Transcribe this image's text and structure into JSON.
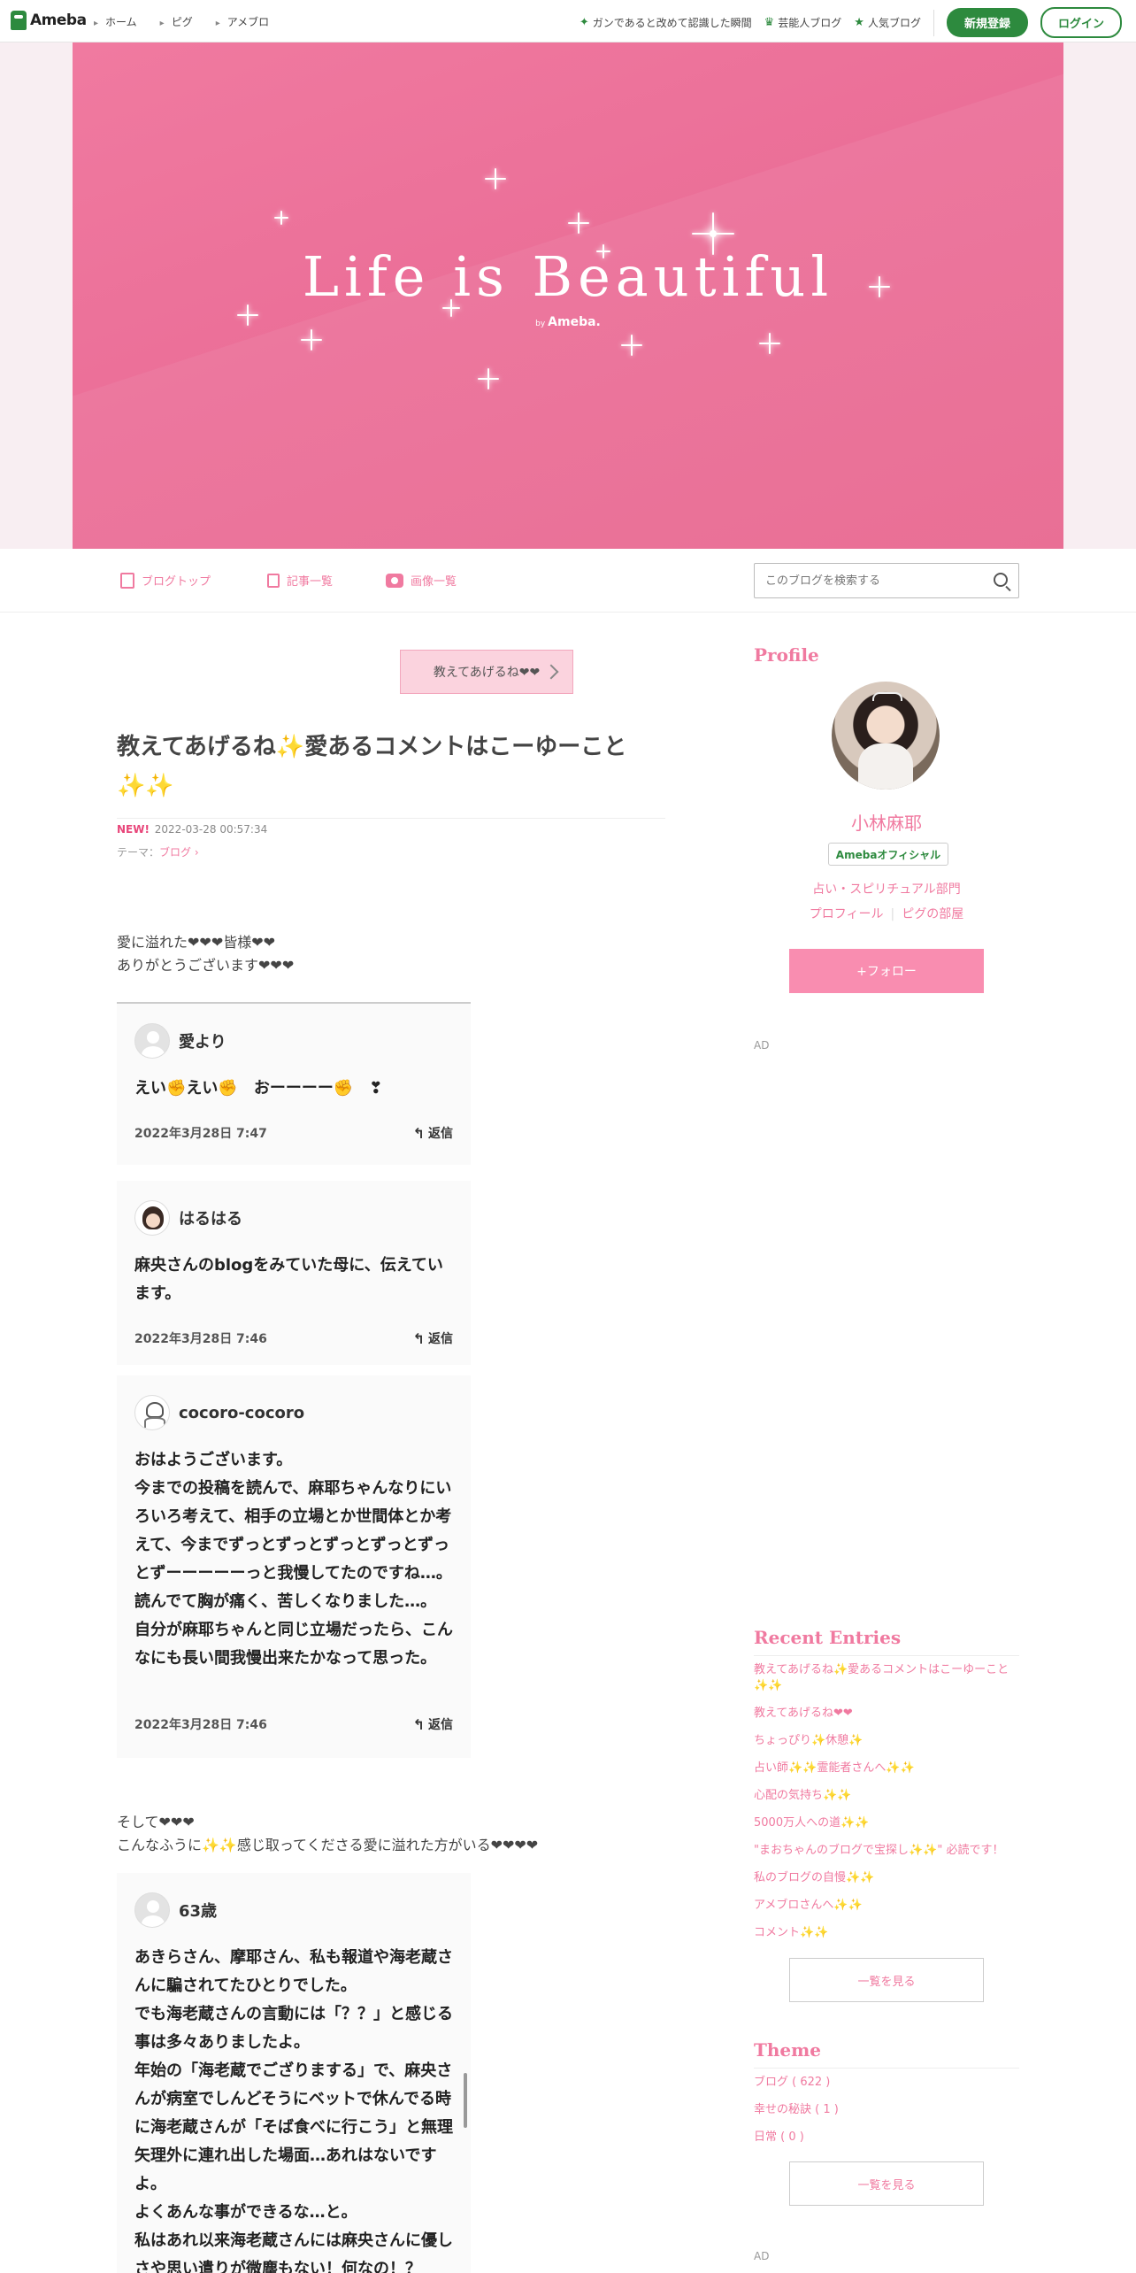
{
  "topbar": {
    "logo_text": "Ameba",
    "nav": [
      "ホーム",
      "ピグ",
      "アメブロ"
    ],
    "right_links": [
      {
        "icon": "sparkle-icon",
        "label": "ガンであると改めて認識した瞬間"
      },
      {
        "icon": "crown-icon",
        "label": "芸能人ブログ"
      },
      {
        "icon": "star-icon",
        "label": "人気ブログ"
      }
    ],
    "signup": "新規登録",
    "login": "ログイン"
  },
  "hero": {
    "title": "Life is Beautiful",
    "by_prefix": "by",
    "by_brand": "Ameba."
  },
  "blognav": {
    "items": [
      "ブログトップ",
      "記事一覧",
      "画像一覧"
    ],
    "search_placeholder": "このブログを検索する"
  },
  "entry": {
    "tag_button": "教えてあげるね❤❤",
    "title": "教えてあげるね✨愛あるコメントはこーゆーこと✨✨",
    "new_label": "NEW!",
    "date": "2022-03-28 00:57:34",
    "theme_label": "テーマ：",
    "theme_value": "ブログ",
    "intro_line1": "愛に溢れた❤❤❤皆様❤❤",
    "intro_line2": "ありがとうございます❤❤❤",
    "mid_line1": "そして❤❤❤",
    "mid_line2": "こんなふうに✨✨感じ取ってくださる愛に溢れた方がいる❤❤❤❤",
    "reply_label": "返信",
    "comments": [
      {
        "name": "愛より",
        "text": "えい✊えい✊　おーーーー✊　❣",
        "date": "2022年3月28日 7:47"
      },
      {
        "name": "はるはる",
        "text": "麻央さんのblogをみていた母に、伝えています。",
        "date": "2022年3月28日 7:46"
      },
      {
        "name": "cocoro-cocoro",
        "text": "おはようございます。\n今までの投稿を読んで、麻耶ちゃんなりにいろいろ考えて、相手の立場とか世間体とか考えて、今までずっとずっとずっとずっとずっとずーーーーーっと我慢してたのですね…。\n読んでて胸が痛く、苦しくなりました…。\n自分が麻耶ちゃんと同じ立場だったら、こんなにも長い間我慢出来たかなって思った。",
        "date": "2022年3月28日 7:46"
      },
      {
        "name": "63歳",
        "text": "あきらさん、摩耶さん、私も報道や海老蔵さんに騙されてたひとりでした。\nでも海老蔵さんの言動には「？？」と感じる事は多々ありましたよ。\n年始の「海老蔵でござりまする」で、麻央さんが病室でしんどそうにベットで休んでる時に海老蔵さんが「そば食べに行こう」と無理矢理外に連れ出した場面…あれはないですよ。\nよくあんな事ができるな…と。\n私はあれ以来海老蔵さんには麻央さんに優しさや思い遣りが微塵もない！何なの！？",
        "date": ""
      }
    ]
  },
  "sidebar": {
    "profile_heading": "Profile",
    "name": "小林麻耶",
    "badge": "Amebaオフィシャル",
    "category": "占い・スピリチュアル部門",
    "link_profile": "プロフィール",
    "link_pig": "ピグの部屋",
    "follow": "+フォロー",
    "ad": "AD",
    "recent_heading": "Recent Entries",
    "recent": [
      "教えてあげるね✨愛あるコメントはこーゆーこと✨✨",
      "教えてあげるね❤❤",
      "ちょっぴり✨休憩✨",
      "占い師✨✨霊能者さんへ✨✨",
      "心配の気持ち✨✨",
      "5000万人への道✨✨",
      "\"まおちゃんのブログで宝探し✨✨\" 必読です！",
      "私のブログの自慢✨✨",
      "アメブロさんへ✨✨",
      "コメント✨✨"
    ],
    "more": "一覧を見る",
    "theme_heading": "Theme",
    "themes": [
      "ブログ ( 622 )",
      "幸せの秘訣 ( 1 )",
      "日常 ( 0 )"
    ]
  },
  "colors": {
    "brand_green": "#2d8a3e",
    "accent_pink": "#f07aa0",
    "hero_pink": "#eb6f98"
  }
}
